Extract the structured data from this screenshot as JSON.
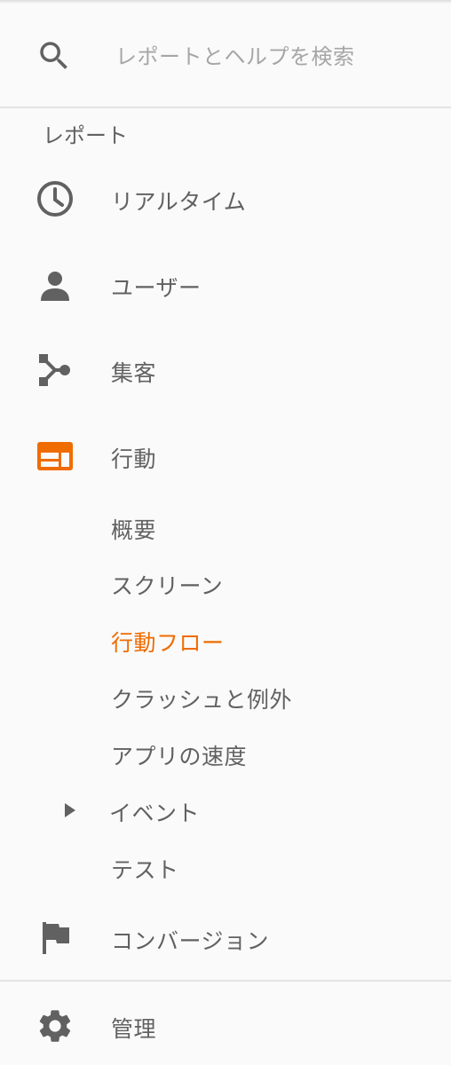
{
  "search": {
    "placeholder": "レポートとヘルプを検索",
    "icon": "search-icon"
  },
  "reports": {
    "section_title": "レポート",
    "items": [
      {
        "label": "リアルタイム",
        "icon": "clock-icon"
      },
      {
        "label": "ユーザー",
        "icon": "person-icon"
      },
      {
        "label": "集客",
        "icon": "acquisition-icon"
      },
      {
        "label": "行動",
        "icon": "behavior-icon",
        "expanded": true,
        "accent": "#ef6c00"
      }
    ],
    "behavior_sub": [
      {
        "label": "概要"
      },
      {
        "label": "スクリーン"
      },
      {
        "label": "行動フロー",
        "active": true
      },
      {
        "label": "クラッシュと例外"
      },
      {
        "label": "アプリの速度"
      },
      {
        "label": "イベント",
        "collapsible": true
      },
      {
        "label": "テスト"
      }
    ],
    "conversions": {
      "label": "コンバージョン",
      "icon": "flag-icon"
    }
  },
  "admin": {
    "label": "管理",
    "icon": "gear-icon"
  },
  "colors": {
    "accent": "#ef6c00",
    "text": "#616161",
    "placeholder": "#a6a6a6",
    "divider": "#e3e3e3"
  }
}
